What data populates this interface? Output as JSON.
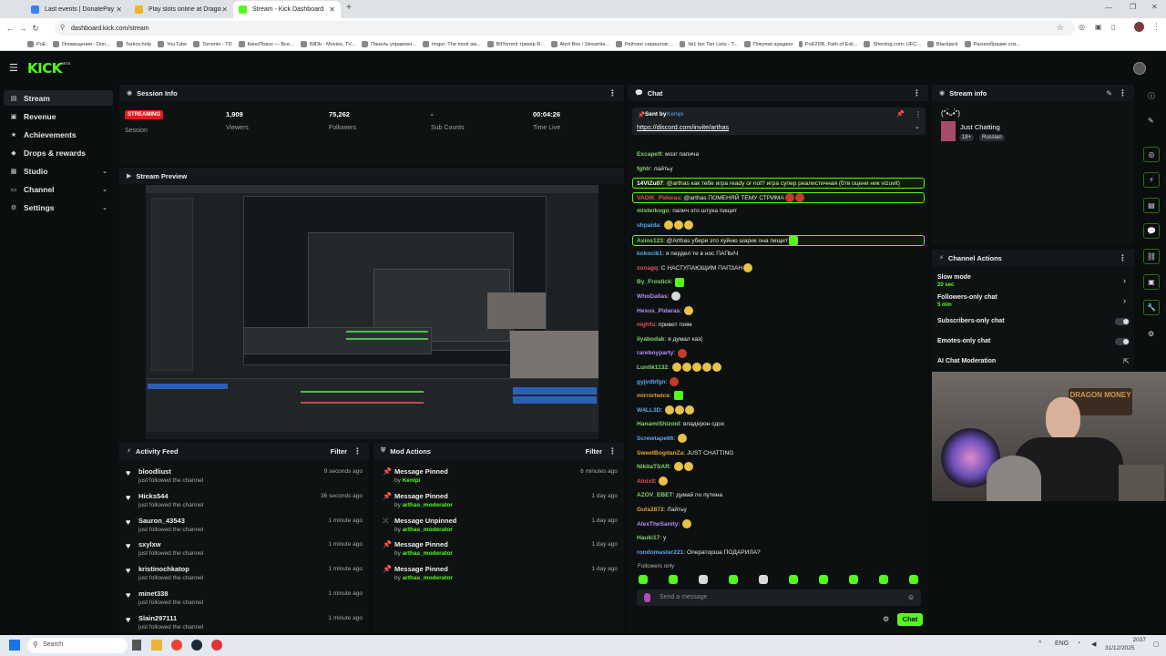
{
  "browser": {
    "tabs": [
      {
        "title": "Last events | DonatePay",
        "active": false,
        "color": "#3b82f6"
      },
      {
        "title": "Play slots online at Dragon Mo",
        "active": false,
        "color": "#f0b429"
      },
      {
        "title": "Stream - Kick Dashboard",
        "active": true,
        "color": "#53fc18"
      }
    ],
    "url": "dashboard.kick.com/stream",
    "bookmarks": [
      "PoE",
      "Оповещения - Don...",
      "Tarkov.help",
      "YouTube",
      "Torrents - TD",
      "КиноПоиск — Все...",
      "IMDb - Movies, TV...",
      "Панель управлен...",
      "Imgur: The most aw...",
      "BitTorrent трекер R...",
      "Alert Box / Streamla...",
      "Рейтинг сериалов:...",
      "№1 fan Tier Lists - T...",
      "Покупки аукцион",
      "PoE2DB, Path of Exil...",
      "Sherdog.com: UFC...",
      "Blackjack",
      "Разнообразие сти..."
    ]
  },
  "logo": "KICK",
  "logo_beta": "BETA",
  "sidebar": {
    "items": [
      {
        "label": "Stream",
        "icon": "stream-icon",
        "glyph": "▤",
        "active": true
      },
      {
        "label": "Revenue",
        "icon": "revenue-icon",
        "glyph": "▣",
        "active": false
      },
      {
        "label": "Achievements",
        "icon": "trophy-icon",
        "glyph": "★",
        "active": false
      },
      {
        "label": "Drops & rewards",
        "icon": "gift-icon",
        "glyph": "◆",
        "active": false
      },
      {
        "label": "Studio",
        "icon": "studio-icon",
        "glyph": "▦",
        "active": false,
        "chevron": true
      },
      {
        "label": "Channel",
        "icon": "channel-icon",
        "glyph": "▭",
        "active": false,
        "chevron": true
      },
      {
        "label": "Settings",
        "icon": "gear-icon",
        "glyph": "⚙",
        "active": false,
        "chevron": true
      }
    ]
  },
  "session": {
    "title": "Session Info",
    "status": "STREAMING",
    "status_label": "Session",
    "stats": [
      {
        "value": "1,909",
        "label": "Viewers"
      },
      {
        "value": "75,262",
        "label": "Followers"
      },
      {
        "value": "-",
        "label": "Sub Counts"
      },
      {
        "value": "00:04:26",
        "label": "Time Live"
      }
    ]
  },
  "preview": {
    "title": "Stream Preview"
  },
  "activity": {
    "title": "Activity Feed",
    "filter": "Filter",
    "items": [
      {
        "name": "bloodliust",
        "sub": "just followed the channel",
        "time": "9 seconds ago"
      },
      {
        "name": "Hicks544",
        "sub": "just followed the channel",
        "time": "36 seconds ago"
      },
      {
        "name": "Sauron_43543",
        "sub": "just followed the channel",
        "time": "1 minute ago"
      },
      {
        "name": "sxylxw",
        "sub": "just followed the channel",
        "time": "1 minute ago"
      },
      {
        "name": "kristinochkatop",
        "sub": "just followed the channel",
        "time": "1 minute ago"
      },
      {
        "name": "minet338",
        "sub": "just followed the channel",
        "time": "1 minute ago"
      },
      {
        "name": "Slain297111",
        "sub": "just followed the channel",
        "time": "1 minute ago"
      }
    ]
  },
  "modactions": {
    "title": "Mod Actions",
    "filter": "Filter",
    "items": [
      {
        "action": "Message Pinned",
        "by": "by",
        "user": "Kenipi",
        "time": "6 minutes ago"
      },
      {
        "action": "Message Pinned",
        "by": "by",
        "user": "arthas_moderator",
        "time": "1 day ago"
      },
      {
        "action": "Message Unpinned",
        "by": "by",
        "user": "arthas_moderator",
        "time": "1 day ago"
      },
      {
        "action": "Message Pinned",
        "by": "by",
        "user": "arthas_moderator",
        "time": "1 day ago"
      },
      {
        "action": "Message Pinned",
        "by": "by",
        "user": "arthas_moderator",
        "time": "1 day ago"
      }
    ]
  },
  "chat": {
    "title": "Chat",
    "pinned_by_label": "Sent by",
    "pinned_by": "Kenipi",
    "pinned_link": "https://discord.com/invite/arthas",
    "messages": [
      {
        "user": "Excapeft",
        "color": "#7fd46b",
        "text": "мозг папича",
        "hl": false,
        "emotes": ""
      },
      {
        "user": "fghtr",
        "color": "#7fd46b",
        "text": "лайтьу",
        "hl": false,
        "emotes": ""
      },
      {
        "user": "14VIZu07",
        "color": "#ffffff",
        "text": "@arthas как тебе игра ready or not? игра супер реалистичная (бтв оцени ник vizuvit)",
        "hl": true,
        "emotes": ""
      },
      {
        "user": "VADIK_Pidoras",
        "color": "#e05252",
        "text": "@arthas ПОМЕНЯЙ ТЕМУ СТРИМА",
        "hl": true,
        "emotes": "rr"
      },
      {
        "user": "misterkogo",
        "color": "#7fd46b",
        "text": "папич это штука пищит",
        "hl": false,
        "emotes": ""
      },
      {
        "user": "shpaida",
        "color": "#5aa6f0",
        "text": "",
        "hl": false,
        "emotes": "yyy"
      },
      {
        "user": "Axios123",
        "color": "#7fd46b",
        "text": "@Arthas убери это хуйню шарик она пищит",
        "hl": true,
        "emotes": "g"
      },
      {
        "user": "kokocik1",
        "color": "#5aa6f0",
        "text": "я пердел те в нос ПАПЫЧ",
        "hl": false,
        "emotes": ""
      },
      {
        "user": "zonagq",
        "color": "#e05252",
        "text": "С НАСТУПАЮЩИМ ПАПЗАН",
        "hl": false,
        "emotes": "y"
      },
      {
        "user": "By_Frostick",
        "color": "#7fd46b",
        "text": "",
        "hl": false,
        "emotes": "g"
      },
      {
        "user": "WhoDallas",
        "color": "#b98df2",
        "text": "",
        "hl": false,
        "emotes": "w"
      },
      {
        "user": "Hesus_Pidaras",
        "color": "#b98df2",
        "text": "",
        "hl": false,
        "emotes": "y"
      },
      {
        "user": "nighfu",
        "color": "#e05252",
        "text": "привет гоям",
        "hl": false,
        "emotes": ""
      },
      {
        "user": "ilyabodak",
        "color": "#7fd46b",
        "text": "я думал каз(",
        "hl": false,
        "emotes": ""
      },
      {
        "user": "rareboyparty",
        "color": "#b98df2",
        "text": "",
        "hl": false,
        "emotes": "r"
      },
      {
        "user": "Luntik1132",
        "color": "#7fd46b",
        "text": "",
        "hl": false,
        "emotes": "yyyyy"
      },
      {
        "user": "gyjvdbfgn",
        "color": "#5aa6f0",
        "text": "",
        "hl": false,
        "emotes": "r"
      },
      {
        "user": "mirrortwice",
        "color": "#e0a23a",
        "text": "",
        "hl": false,
        "emotes": "g"
      },
      {
        "user": "W4LL3D",
        "color": "#5aa6f0",
        "text": "",
        "hl": false,
        "emotes": "yyy"
      },
      {
        "user": "HanamiShizoid",
        "color": "#7fd46b",
        "text": "владерон сдох",
        "hl": false,
        "emotes": ""
      },
      {
        "user": "Screwtape66",
        "color": "#5aa6f0",
        "text": "",
        "hl": false,
        "emotes": "y"
      },
      {
        "user": "SweetBogdanZa",
        "color": "#e0a23a",
        "text": "JUST CHATTING",
        "hl": false,
        "emotes": ""
      },
      {
        "user": "NikitaTSAR",
        "color": "#7fd46b",
        "text": "",
        "hl": false,
        "emotes": "yy"
      },
      {
        "user": "Alnix9",
        "color": "#e05252",
        "text": "",
        "hl": false,
        "emotes": "y"
      },
      {
        "user": "AZOV_EBET",
        "color": "#7fd46b",
        "text": "думай по путина",
        "hl": false,
        "emotes": ""
      },
      {
        "user": "Guts2872",
        "color": "#e0a23a",
        "text": "Лайтьу",
        "hl": false,
        "emotes": ""
      },
      {
        "user": "AlexTheSanity",
        "color": "#b98df2",
        "text": "",
        "hl": false,
        "emotes": "y"
      },
      {
        "user": "Hauki17",
        "color": "#7fd46b",
        "text": "у",
        "hl": false,
        "emotes": ""
      },
      {
        "user": "rondomaster221",
        "color": "#5aa6f0",
        "text": "Операторша ПОДАРИЛА?",
        "hl": false,
        "emotes": ""
      }
    ],
    "followers_only": "Followers only",
    "input_placeholder": "Send a message",
    "send_label": "Chat"
  },
  "stream_info": {
    "title": "Stream info",
    "stream_title": "(\"•̀ᴗ•́\")",
    "category": "Just Chatting",
    "tags": [
      "18+",
      "Russian"
    ]
  },
  "channel_actions": {
    "title": "Channel Actions",
    "items": [
      {
        "label": "Slow mode",
        "sub": "20 sec",
        "kind": "chevron"
      },
      {
        "label": "Followers-only chat",
        "sub": "5 min",
        "kind": "chevron"
      },
      {
        "label": "Subscribers-only chat",
        "sub": "",
        "kind": "toggle"
      },
      {
        "label": "Emotes-only chat",
        "sub": "",
        "kind": "toggle"
      },
      {
        "label": "AI Chat Moderation",
        "sub": "",
        "kind": "link"
      }
    ]
  },
  "webcam_sign": "DRAGON MONEY",
  "taskbar": {
    "search": "Search",
    "lang": "ENG",
    "time": "2037",
    "date": "31/12/2025"
  }
}
